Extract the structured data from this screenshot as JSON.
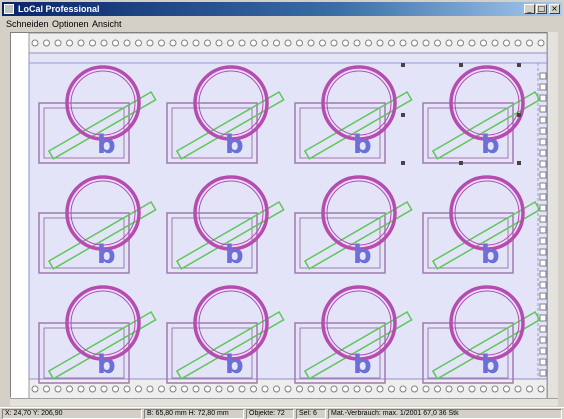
{
  "window": {
    "title": "LoCal Professional",
    "controls": {
      "minimize": "_",
      "maximize": "□",
      "close": "×"
    }
  },
  "menu": {
    "items": [
      "Schneiden",
      "Optionen",
      "Ansicht"
    ]
  },
  "status": {
    "cursor": "X: 24,70 Y: 206,90",
    "size": "B: 65,80 mm   H: 72,80 mm",
    "objects": "Objekte: 72",
    "selection": "Sel: 6",
    "material": "Mat.-Verbrauch: max. 1/2001 67,0 36 Stk"
  },
  "drawing": {
    "rows": 3,
    "cols": 4,
    "motif_letter": "b",
    "colors": {
      "sheet": "#e4e4f8",
      "circle": "#b64bb0",
      "frame": "#a07ab0",
      "strip": "#5fc75a",
      "letter": "#6a70d8",
      "handles": "#444444",
      "holes": "#808080"
    }
  },
  "icons": {
    "app": "window-app-icon",
    "scroll_arrow": "scroll-arrow-icon"
  }
}
